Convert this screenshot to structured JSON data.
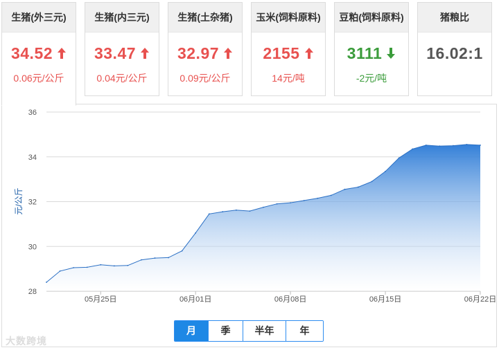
{
  "cards": [
    {
      "title": "生猪(外三元)",
      "value": "34.52",
      "change": "0.06元/公斤",
      "trend": "up"
    },
    {
      "title": "生猪(内三元)",
      "value": "33.47",
      "change": "0.04元/公斤",
      "trend": "up"
    },
    {
      "title": "生猪(土杂猪)",
      "value": "32.97",
      "change": "0.09元/公斤",
      "trend": "up"
    },
    {
      "title": "玉米(饲料原料)",
      "value": "2155",
      "change": "14元/吨",
      "trend": "up"
    },
    {
      "title": "豆粕(饲料原料)",
      "value": "3111",
      "change": "-2元/吨",
      "trend": "down"
    },
    {
      "title": "猪粮比",
      "value": "16.02:1",
      "change": "",
      "trend": "none"
    }
  ],
  "colors": {
    "up": "#e8514f",
    "down": "#3b9c3b",
    "accent": "#1e88e5"
  },
  "period_tabs": {
    "items": [
      "月",
      "季",
      "半年",
      "年"
    ],
    "selected": "月"
  },
  "watermark": "大数跨境",
  "chart_data": {
    "type": "area",
    "ylabel": "元/公斤",
    "ylim": [
      28,
      36
    ],
    "yticks": [
      28,
      30,
      32,
      34,
      36
    ],
    "xtick_labels": [
      "05月25日",
      "06月01日",
      "06月08日",
      "06月15日",
      "06月22日"
    ],
    "xtick_index": [
      4,
      11,
      18,
      25,
      32
    ],
    "grid": true,
    "x": [
      "05-21",
      "05-22",
      "05-23",
      "05-24",
      "05-25",
      "05-26",
      "05-27",
      "05-28",
      "05-29",
      "05-30",
      "05-31",
      "06-01",
      "06-02",
      "06-03",
      "06-04",
      "06-05",
      "06-06",
      "06-07",
      "06-08",
      "06-09",
      "06-10",
      "06-11",
      "06-12",
      "06-13",
      "06-14",
      "06-15",
      "06-16",
      "06-17",
      "06-18",
      "06-19",
      "06-20",
      "06-21",
      "06-22"
    ],
    "values": [
      28.4,
      28.9,
      29.05,
      29.07,
      29.18,
      29.13,
      29.15,
      29.4,
      29.48,
      29.5,
      29.8,
      30.6,
      31.45,
      31.55,
      31.62,
      31.58,
      31.75,
      31.9,
      31.95,
      32.05,
      32.15,
      32.28,
      32.55,
      32.65,
      32.9,
      33.35,
      33.95,
      34.35,
      34.52,
      34.48,
      34.5,
      34.55,
      34.52
    ]
  }
}
